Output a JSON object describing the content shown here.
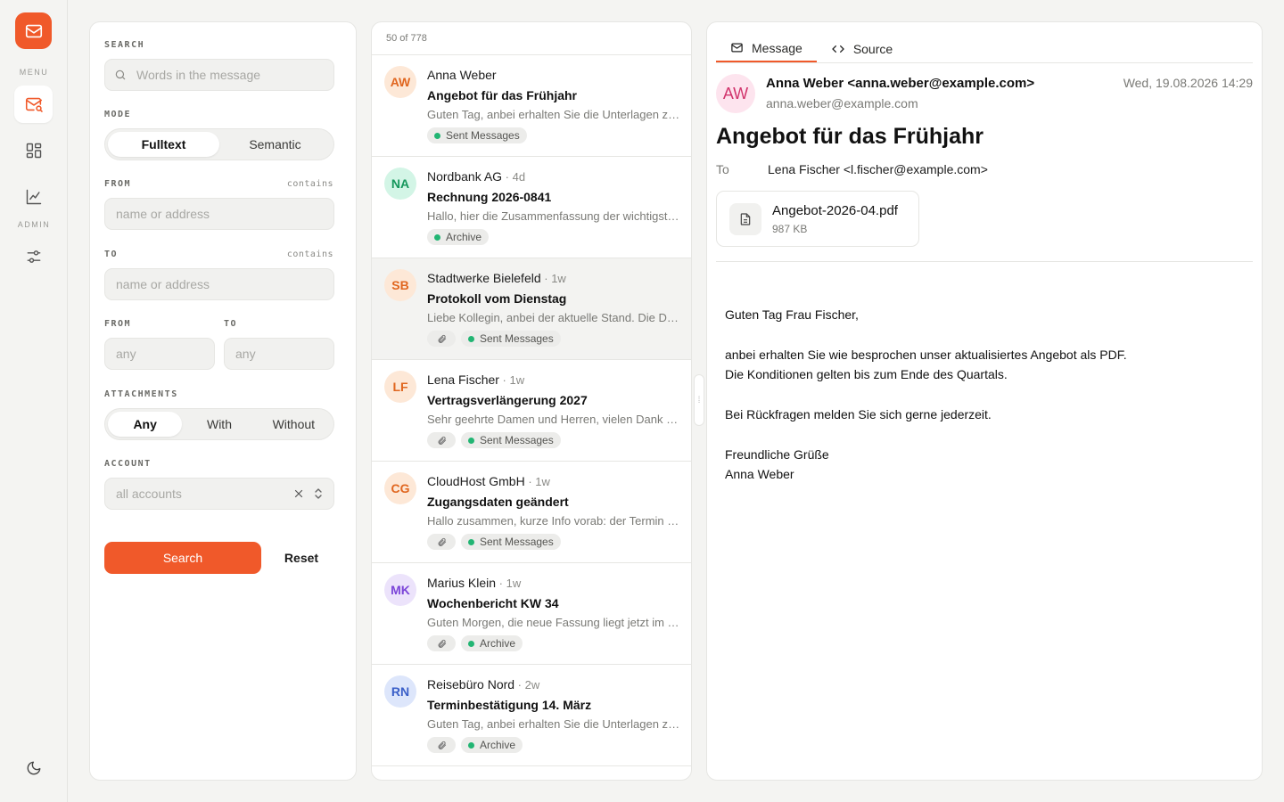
{
  "rail": {
    "menu_label": "MENU",
    "admin_label": "ADMIN",
    "items": [
      {
        "icon": "mail-search-icon",
        "active": true
      },
      {
        "icon": "dashboard-icon",
        "active": false
      },
      {
        "icon": "chart-icon",
        "active": false
      },
      {
        "icon": "settings-sliders-icon",
        "active": false
      }
    ],
    "theme_icon": "moon-icon"
  },
  "filter": {
    "search_label": "SEARCH",
    "search_placeholder": "Words in the message",
    "mode_label": "MODE",
    "mode_options": [
      "Fulltext",
      "Semantic"
    ],
    "mode_selected": "Fulltext",
    "from_label": "FROM",
    "from_hint": "contains",
    "from_placeholder": "name or address",
    "to_label": "TO",
    "to_hint": "contains",
    "to_placeholder": "name or address",
    "date_from_label": "FROM",
    "date_from_placeholder": "any",
    "date_to_label": "TO",
    "date_to_placeholder": "any",
    "attachments_label": "ATTACHMENTS",
    "attachments_options": [
      "Any",
      "With",
      "Without"
    ],
    "attachments_selected": "Any",
    "account_label": "ACCOUNT",
    "account_placeholder": "all accounts",
    "search_button": "Search",
    "reset_button": "Reset",
    "accent": "#f0592a"
  },
  "list": {
    "count_text": "50 of 778",
    "items": [
      {
        "initials": "AW",
        "from": "Anna Weber",
        "age": "",
        "subject": "Angebot für das Frühjahr",
        "preview": "Guten Tag, anbei erhalten Sie die Unterlagen zu unserem Angebot",
        "clip": false,
        "tag": "Sent Messages",
        "avatar_bg": "#fde8d7",
        "avatar_fg": "#e0661f",
        "selected": false
      },
      {
        "initials": "NA",
        "from": "Nordbank AG",
        "age": "4d",
        "subject": "Rechnung 2026-0841",
        "preview": "Hallo, hier die Zusammenfassung der wichtigsten Punkte",
        "clip": false,
        "tag": "Archive",
        "avatar_bg": "#d3f5e6",
        "avatar_fg": "#16975c",
        "selected": false
      },
      {
        "initials": "SB",
        "from": "Stadtwerke Bielefeld",
        "age": "1w",
        "subject": "Protokoll vom Dienstag",
        "preview": "Liebe Kollegin, anbei der aktuelle Stand. Die Details folgen",
        "clip": true,
        "tag": "Sent Messages",
        "avatar_bg": "#fde8d7",
        "avatar_fg": "#e0661f",
        "selected": true
      },
      {
        "initials": "LF",
        "from": "Lena Fischer",
        "age": "1w",
        "subject": "Vertragsverlängerung 2027",
        "preview": "Sehr geehrte Damen und Herren, vielen Dank für Ihre Nachricht",
        "clip": true,
        "tag": "Sent Messages",
        "avatar_bg": "#fde8d7",
        "avatar_fg": "#e0661f",
        "selected": false
      },
      {
        "initials": "CG",
        "from": "CloudHost GmbH",
        "age": "1w",
        "subject": "Zugangsdaten geändert",
        "preview": "Hallo zusammen, kurze Info vorab: der Termin verschiebt sich",
        "clip": true,
        "tag": "Sent Messages",
        "avatar_bg": "#fde8d7",
        "avatar_fg": "#e0661f",
        "selected": false
      },
      {
        "initials": "MK",
        "from": "Marius Klein",
        "age": "1w",
        "subject": "Wochenbericht KW 34",
        "preview": "Guten Morgen, die neue Fassung liegt jetzt im Ordner bereit",
        "clip": true,
        "tag": "Archive",
        "avatar_bg": "#ece3fb",
        "avatar_fg": "#7a44d8",
        "selected": false
      },
      {
        "initials": "RN",
        "from": "Reisebüro Nord",
        "age": "2w",
        "subject": "Terminbestätigung 14. März",
        "preview": "Guten Tag, anbei erhalten Sie die Unterlagen zu Ihrer Reise",
        "clip": true,
        "tag": "Archive",
        "avatar_bg": "#dde6fb",
        "avatar_fg": "#3a5fc8",
        "selected": false
      }
    ]
  },
  "reader": {
    "tabs": [
      {
        "label": "Message",
        "icon": "mail-icon",
        "active": true
      },
      {
        "label": "Source",
        "icon": "code-icon",
        "active": false
      }
    ],
    "avatar_initials": "AW",
    "from": "Anna Weber <anna.weber@example.com>",
    "from_address": "anna.weber@example.com",
    "date": "Wed, 19.08.2026 14:29",
    "subject": "Angebot für das Frühjahr",
    "to_label": "To",
    "to": "Lena Fischer <l.fischer@example.com>",
    "attachment": {
      "name": "Angebot-2026-04.pdf",
      "size": "987 KB",
      "icon": "file-icon"
    },
    "body": [
      "Guten Tag Frau Fischer,",
      "anbei erhalten Sie wie besprochen unser aktualisiertes Angebot als PDF.",
      "Die Konditionen gelten bis zum Ende des Quartals.",
      "Bei Rückfragen melden Sie sich gerne jederzeit.",
      "Freundliche Grüße",
      "Anna Weber"
    ]
  }
}
